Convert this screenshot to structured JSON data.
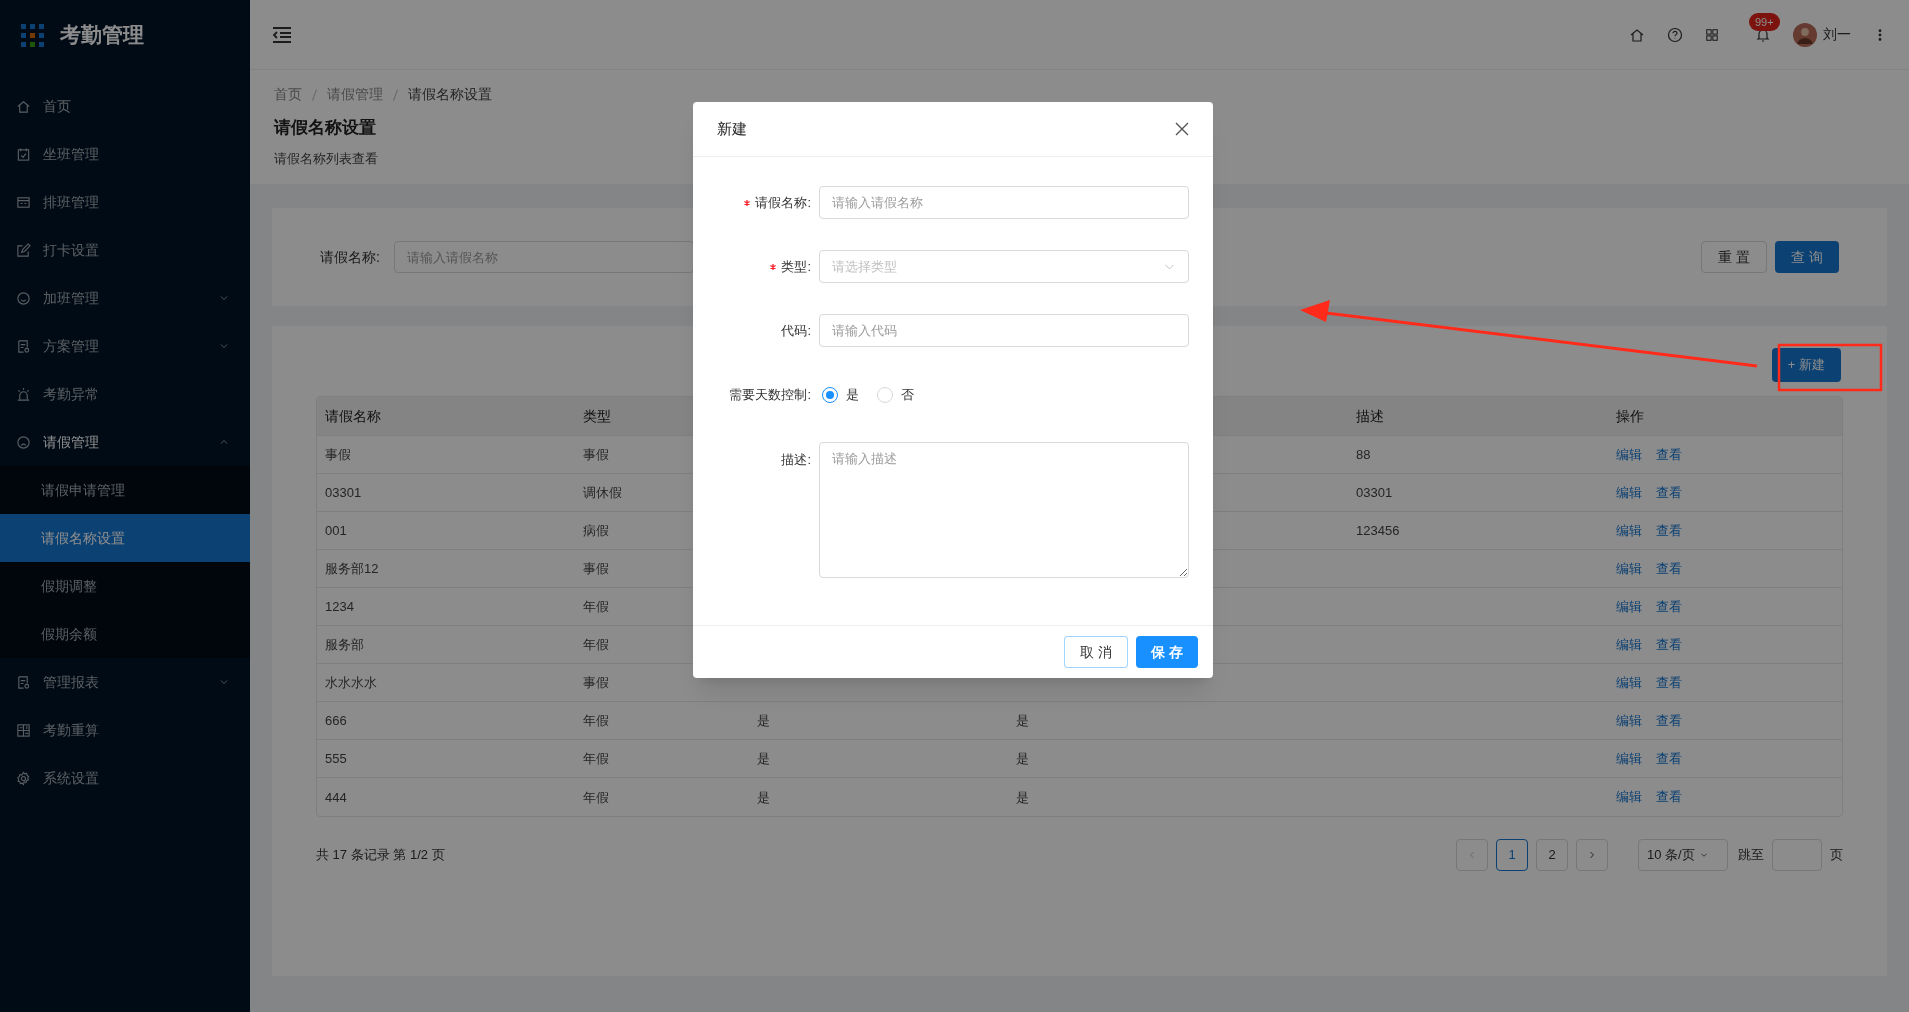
{
  "app": {
    "title": "考勤管理"
  },
  "sidebar": {
    "items": [
      {
        "label": "首页",
        "selected": false
      },
      {
        "label": "坐班管理",
        "selected": false
      },
      {
        "label": "排班管理",
        "selected": false
      },
      {
        "label": "打卡设置",
        "selected": false
      },
      {
        "label": "加班管理",
        "selected": false,
        "expanded": false
      },
      {
        "label": "方案管理",
        "selected": false,
        "expanded": false
      },
      {
        "label": "考勤异常",
        "selected": false
      },
      {
        "label": "请假管理",
        "selected": false,
        "expanded": true,
        "children": [
          {
            "label": "请假申请管理",
            "selected": false
          },
          {
            "label": "请假名称设置",
            "selected": true
          },
          {
            "label": "假期调整",
            "selected": false
          },
          {
            "label": "假期余额",
            "selected": false
          }
        ]
      },
      {
        "label": "管理报表",
        "selected": false,
        "expanded": false
      },
      {
        "label": "考勤重算",
        "selected": false
      },
      {
        "label": "系统设置",
        "selected": false
      }
    ]
  },
  "header": {
    "notification_badge": "99+",
    "user": "刘一"
  },
  "breadcrumb": [
    "首页",
    "请假管理",
    "请假名称设置"
  ],
  "page": {
    "title": "请假名称设置",
    "subtitle": "请假名称列表查看"
  },
  "search": {
    "label": "请假名称:",
    "placeholder": "请输入请假名称",
    "buttons": [
      {
        "label": "重 置",
        "kind": "default"
      },
      {
        "label": "查 询",
        "kind": "primary"
      }
    ]
  },
  "new_button": "+ 新建",
  "table": {
    "columns": [
      {
        "label": "请假名称"
      },
      {
        "label": "类型"
      },
      {},
      {},
      {
        "label": "描述"
      },
      {
        "label": "操作"
      }
    ],
    "rows": [
      {
        "cells": [
          "事假",
          "事假",
          "",
          "",
          "88"
        ],
        "actions": [
          "编辑",
          "查看"
        ]
      },
      {
        "cells": [
          "03301",
          "调休假",
          "",
          "",
          "03301"
        ],
        "actions": [
          "编辑",
          "查看"
        ]
      },
      {
        "cells": [
          "001",
          "病假",
          "",
          "",
          "123456"
        ],
        "actions": [
          "编辑",
          "查看"
        ]
      },
      {
        "cells": [
          "服务部12",
          "事假",
          "",
          "",
          ""
        ],
        "actions": [
          "编辑",
          "查看"
        ]
      },
      {
        "cells": [
          "1234",
          "年假",
          "",
          "",
          ""
        ],
        "actions": [
          "编辑",
          "查看"
        ]
      },
      {
        "cells": [
          "服务部",
          "年假",
          "",
          "",
          ""
        ],
        "actions": [
          "编辑",
          "查看"
        ]
      },
      {
        "cells": [
          "水水水水",
          "事假",
          "",
          "",
          ""
        ],
        "actions": [
          "编辑",
          "查看"
        ]
      },
      {
        "cells": [
          "666",
          "年假",
          "是",
          "是",
          ""
        ],
        "actions": [
          "编辑",
          "查看"
        ]
      },
      {
        "cells": [
          "555",
          "年假",
          "是",
          "是",
          ""
        ],
        "actions": [
          "编辑",
          "查看"
        ]
      },
      {
        "cells": [
          "444",
          "年假",
          "是",
          "是",
          ""
        ],
        "actions": [
          "编辑",
          "查看"
        ]
      }
    ]
  },
  "pagination": {
    "summary": "共 17 条记录 第 1/2 页",
    "pages": [
      {
        "label": "1",
        "selected": true
      },
      {
        "label": "2",
        "selected": false
      }
    ],
    "page_size": "10 条/页",
    "jump_label": "跳至",
    "page_unit": "页"
  },
  "dialog": {
    "title": "新建",
    "fields": [
      {
        "kind": "input",
        "label": "请假名称:",
        "required": true,
        "placeholder": "请输入请假名称"
      },
      {
        "kind": "select",
        "label": "类型:",
        "required": true,
        "placeholder": "请选择类型"
      },
      {
        "kind": "input",
        "label": "代码:",
        "required": false,
        "placeholder": "请输入代码"
      },
      {
        "kind": "radio",
        "label": "需要天数控制:",
        "required": false,
        "options": [
          {
            "label": "是",
            "selected": true
          },
          {
            "label": "否",
            "selected": false
          }
        ]
      },
      {
        "kind": "textarea",
        "label": "描述:",
        "required": false,
        "placeholder": "请输入描述"
      }
    ],
    "buttons": [
      {
        "label": "取 消",
        "kind": "default"
      },
      {
        "label": "保 存",
        "kind": "primary"
      }
    ]
  }
}
